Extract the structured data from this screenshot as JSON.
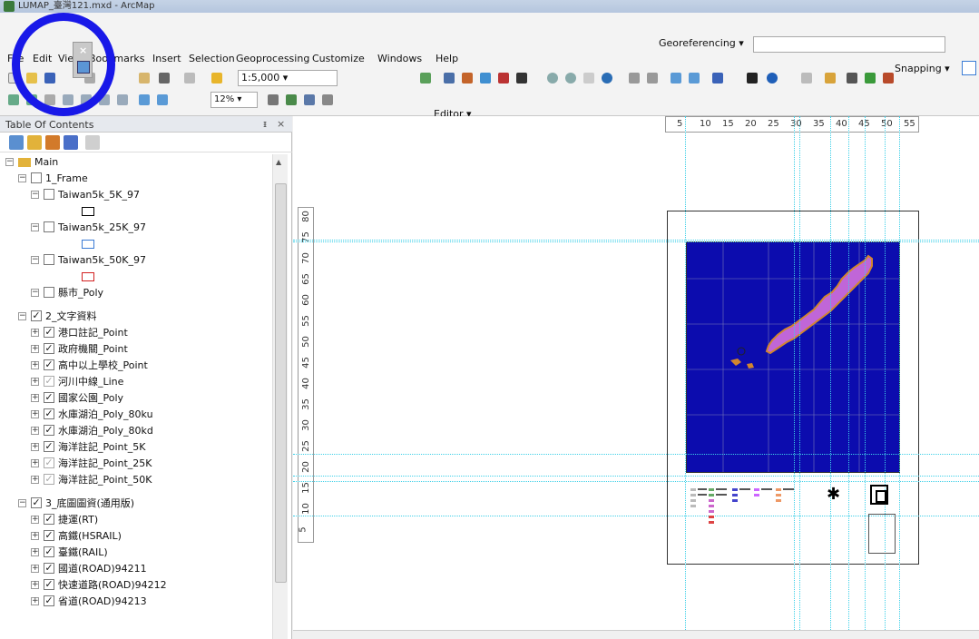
{
  "window": {
    "title": "LUMAP_臺灣121.mxd - ArcMap"
  },
  "menu": [
    "File",
    "Edit",
    "View",
    "Bookmarks",
    "Insert",
    "Selection",
    "Geoprocessing",
    "Customize",
    "Windows",
    "Help"
  ],
  "georeferencing": {
    "label": "Georeferencing ▾"
  },
  "snapping": {
    "label": "Snapping ▾"
  },
  "standard_toolbar": {
    "scale_value": "1:5,000 ▾"
  },
  "layout_toolbar": {
    "zoom_value": "12% ▾"
  },
  "editor_toolbar": {
    "label": "Editor ▾"
  },
  "toc": {
    "title": "Table Of Contents",
    "pin": "ᵻ",
    "close": "×",
    "root": "Main",
    "groups": [
      {
        "name": "1_Frame",
        "checked": false,
        "layers": [
          {
            "name": "Taiwan5k_5K_97",
            "checked": false,
            "symbol_color": "#000000"
          },
          {
            "name": "Taiwan5k_25K_97",
            "checked": false,
            "symbol_color": "#3a7bd5"
          },
          {
            "name": "Taiwan5k_50K_97",
            "checked": false,
            "symbol_color": "#d22020"
          },
          {
            "name": "縣市_Poly",
            "checked": false
          }
        ]
      },
      {
        "name": "2_文字資料",
        "checked": true,
        "layers": [
          {
            "name": "港口註記_Point",
            "checked": true
          },
          {
            "name": "政府機關_Point",
            "checked": true
          },
          {
            "name": "高中以上學校_Point",
            "checked": true
          },
          {
            "name": "河川中線_Line",
            "checked": true,
            "gray": true
          },
          {
            "name": "國家公園_Poly",
            "checked": true
          },
          {
            "name": "水庫湖泊_Poly_80ku",
            "checked": true
          },
          {
            "name": "水庫湖泊_Poly_80kd",
            "checked": true
          },
          {
            "name": "海洋註記_Point_5K",
            "checked": true
          },
          {
            "name": "海洋註記_Point_25K",
            "checked": true,
            "gray": true
          },
          {
            "name": "海洋註記_Point_50K",
            "checked": true,
            "gray": true
          }
        ]
      },
      {
        "name": "3_底圖圖資(通用版)",
        "checked": true,
        "layers": [
          {
            "name": "捷運(RT)",
            "checked": true
          },
          {
            "name": "高鐵(HSRAIL)",
            "checked": true
          },
          {
            "name": "臺鐵(RAIL)",
            "checked": true
          },
          {
            "name": "國道(ROAD)94211",
            "checked": true
          },
          {
            "name": "快速道路(ROAD)94212",
            "checked": true
          },
          {
            "name": "省道(ROAD)94213",
            "checked": true
          }
        ]
      }
    ]
  },
  "rulers": {
    "top": [
      "5",
      "10",
      "15",
      "20",
      "25",
      "30",
      "35",
      "40",
      "45",
      "50",
      "55"
    ],
    "left": [
      "80",
      "75",
      "70",
      "65",
      "60",
      "55",
      "50",
      "45",
      "40",
      "35",
      "30",
      "25",
      "20",
      "15",
      "10",
      "5"
    ]
  },
  "colors": {
    "map_background": "#0c0cae",
    "land": "#c066d8",
    "land_edge": "#d2862e",
    "guide": "#3fd0e8",
    "highlight_circle": "#1818e8"
  }
}
